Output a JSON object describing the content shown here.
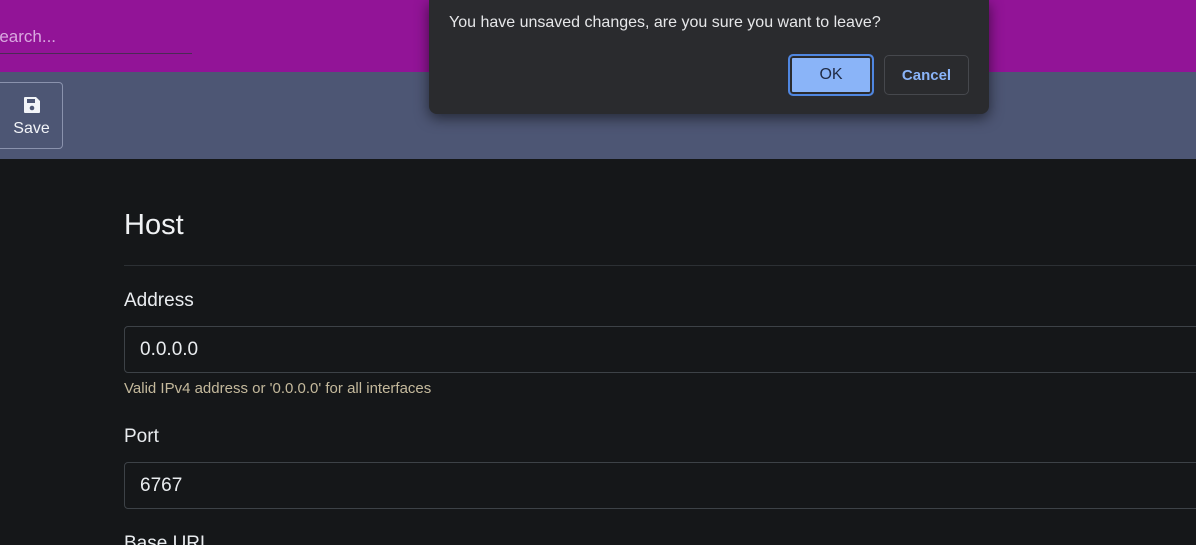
{
  "search": {
    "placeholder": "Search..."
  },
  "toolbar": {
    "save_label": "Save"
  },
  "host": {
    "title": "Host",
    "address": {
      "label": "Address",
      "value": "0.0.0.0",
      "help": "Valid IPv4 address or '0.0.0.0' for all interfaces"
    },
    "port": {
      "label": "Port",
      "value": "6767"
    },
    "base_url": {
      "label": "Base URL"
    }
  },
  "dialog": {
    "message": "You have unsaved changes, are you sure you want to leave?",
    "ok_label": "OK",
    "cancel_label": "Cancel"
  },
  "icons": {
    "save": "floppy-disk-icon"
  },
  "colors": {
    "topbar": "#921497",
    "toolbar": "#4d5674",
    "background": "#151719",
    "dialog_accent": "#8ab4f8"
  }
}
